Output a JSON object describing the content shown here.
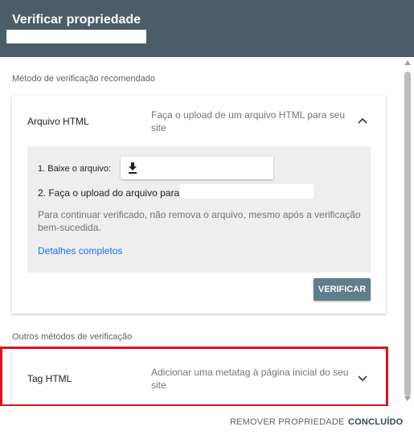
{
  "header": {
    "title": "Verificar propriedade"
  },
  "recommended": {
    "label": "Método de verificação recomendado",
    "card": {
      "title": "Arquivo HTML",
      "description": "Faça o upload de um arquivo HTML para seu site",
      "chevron_icon": "chevron-up-icon",
      "step1_label": "1. Baixe o arquivo:",
      "download_icon": "download-icon",
      "step2_label": "2. Faça o upload do arquivo para:",
      "note": "Para continuar verificado, não remova o arquivo, mesmo após a verificação bem-sucedida.",
      "details_link": "Detalhes completos",
      "verify_button": "VERIFICAR"
    }
  },
  "others": {
    "label": "Outros métodos de verificação",
    "card": {
      "title": "Tag HTML",
      "description": "Adicionar uma metatag à página inicial do seu site",
      "chevron_icon": "chevron-down-icon"
    }
  },
  "footer": {
    "remove_button": "REMOVER PROPRIEDADE",
    "done_button": "CONCLUÍDO"
  },
  "colors": {
    "header_bg": "#4a5d69",
    "verify_button_bg": "#607d8b",
    "link": "#1a73e8",
    "highlight_border": "#d5161b"
  }
}
